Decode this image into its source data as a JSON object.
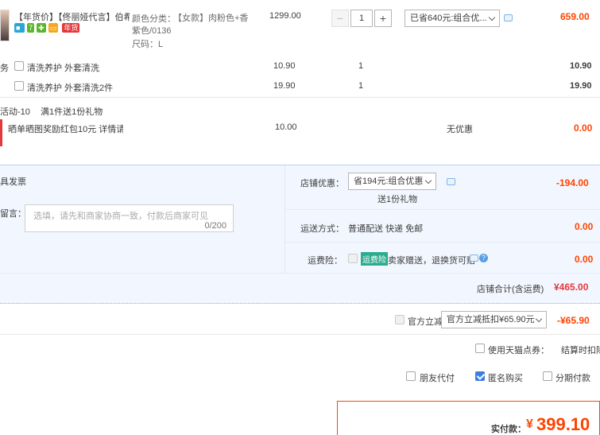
{
  "product": {
    "title": "【年货价】【佟丽娅代言】伯希...",
    "badge_tag": "年货",
    "sku_label": "颜色分类：",
    "sku_color": "【女款】肉粉色+香紫色/0136",
    "size": "尺码：L",
    "unit_price": "1299.00",
    "quantity": "1",
    "discount_select": "已省640元:组合优...",
    "subtotal": "659.00"
  },
  "services": {
    "prefix": "务",
    "items": [
      {
        "label": "清洗养护 外套清洗",
        "price": "10.90",
        "qty": "1",
        "total": "10.90"
      },
      {
        "label": "清洗养护 外套清洗2件",
        "price": "19.90",
        "qty": "1",
        "total": "19.90"
      }
    ]
  },
  "promo": {
    "title": "活动-10",
    "desc": "满1件送1份礼物",
    "item_label": "晒单晒图奖励红包10元 详情请...",
    "price": "10.00",
    "discount": "无优惠",
    "total": "0.00"
  },
  "invoice_label": "具发票",
  "message": {
    "label": "留言：",
    "placeholder": "选填，请先和商家协商一致，付款后商家可见",
    "counter": "0/200"
  },
  "shop_discount": {
    "label": "店铺优惠：",
    "select": "省194元:组合优惠",
    "gift": "送1份礼物",
    "amount": "-194.00"
  },
  "shipping": {
    "label": "运送方式：",
    "value": "普通配送 快递 免邮",
    "amount": "0.00"
  },
  "freight_insurance": {
    "label": "运费险：",
    "tag": "运费险",
    "desc": "卖家赠送，退换货可赔",
    "amount": "0.00"
  },
  "shop_total": {
    "label": "店铺合计(含运费)",
    "amount": "¥465.00"
  },
  "official": {
    "label": "官方立减",
    "select": "官方立减抵扣¥65.90元",
    "amount": "-¥65.90"
  },
  "points": {
    "label": "使用天猫点券：",
    "tail": "结算时扣除"
  },
  "pay_options": {
    "friend": "朋友代付",
    "anonymous": "匿名购买",
    "third": "分期付款"
  },
  "payment": {
    "label": "实付款：",
    "currency": "¥",
    "amount": "399.10"
  },
  "colors": {
    "accent": "#ff4400",
    "total_red": "#e4393c",
    "panel_blue": "#f2f7ff"
  }
}
